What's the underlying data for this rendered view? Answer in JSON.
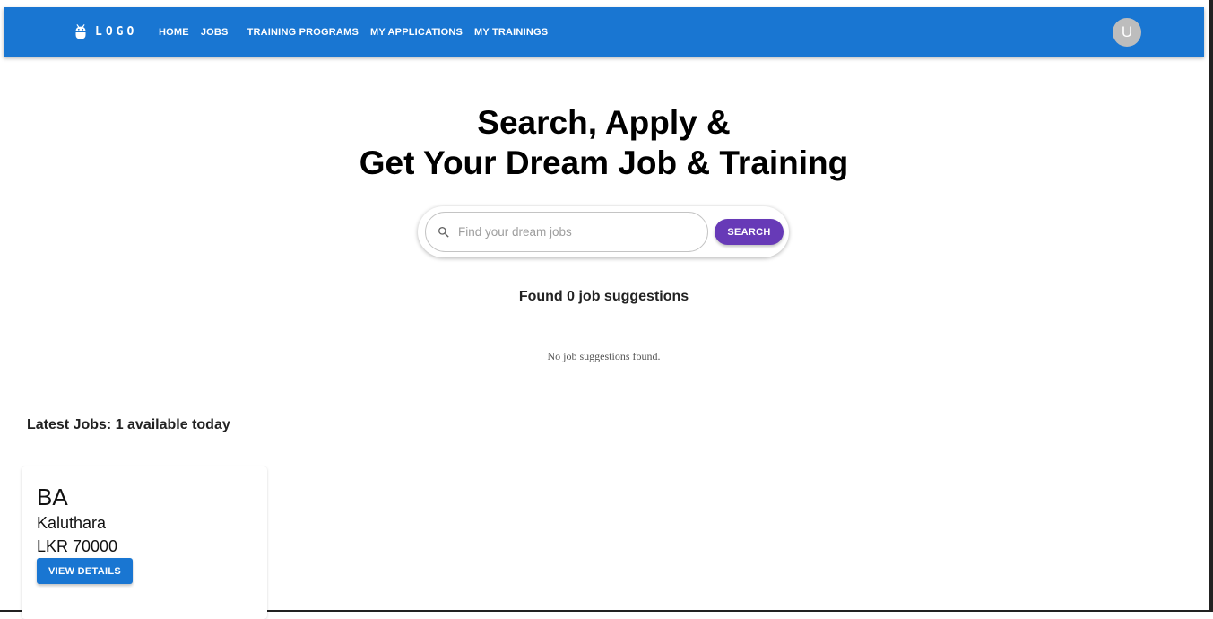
{
  "header": {
    "logo_text": "LOGO",
    "logo_icon": "adb-robot-icon",
    "nav": [
      {
        "label": "HOME"
      },
      {
        "label": "JOBS"
      },
      {
        "label": "TRAINING PROGRAMS"
      },
      {
        "label": "MY APPLICATIONS"
      },
      {
        "label": "MY TRAININGS"
      }
    ],
    "avatar_initial": "U",
    "color": "#1976d2"
  },
  "hero": {
    "line1": "Search, Apply &",
    "line2": "Get Your Dream Job & Training"
  },
  "search": {
    "placeholder": "Find your dream jobs",
    "value": "",
    "button_label": "SEARCH",
    "button_color": "#673ab7",
    "icon": "search-icon"
  },
  "suggestions": {
    "found_text": "Found 0 job suggestions",
    "empty_text": "No job suggestions found."
  },
  "latest": {
    "heading": "Latest Jobs: 1 available today",
    "jobs": [
      {
        "title": "BA",
        "location": "Kaluthara",
        "salary": "LKR 70000",
        "button_label": "VIEW DETAILS"
      }
    ]
  }
}
